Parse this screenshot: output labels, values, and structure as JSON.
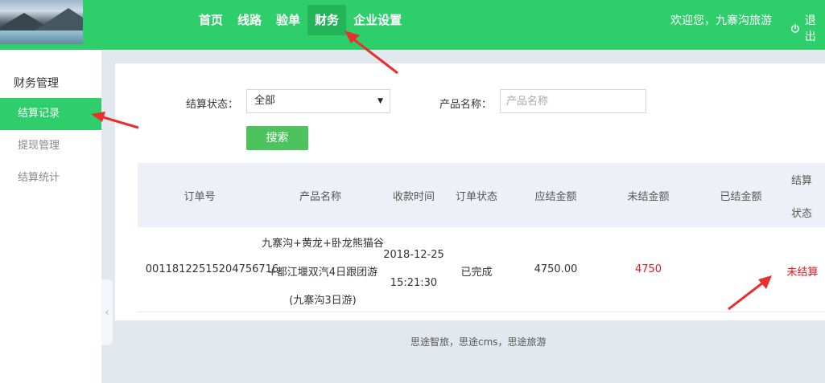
{
  "header": {
    "nav": [
      {
        "label": "首页"
      },
      {
        "label": "线路"
      },
      {
        "label": "验单"
      },
      {
        "label": "财务",
        "active": true
      },
      {
        "label": "企业设置"
      }
    ],
    "welcome": "欢迎您，九寨沟旅游",
    "logout_label": "退出"
  },
  "sidebar": {
    "title": "财务管理",
    "items": [
      {
        "label": "结算记录",
        "active": true
      },
      {
        "label": "提现管理"
      },
      {
        "label": "结算统计"
      }
    ],
    "collapse_glyph": "‹"
  },
  "filters": {
    "status_label": "结算状态：",
    "status_value": "全部",
    "product_label": "产品名称：",
    "product_placeholder": "产品名称",
    "product_value": "",
    "search_label": "搜索"
  },
  "table": {
    "columns": [
      "订单号",
      "产品名称",
      "收款时间",
      "订单状态",
      "应结金额",
      "未结金额",
      "已结金额",
      "结算",
      "状态"
    ],
    "rows": [
      {
        "order_no": "00118122515204756716",
        "product_lines": [
          "九寨沟+黄龙+卧龙熊猫谷",
          "+都江堰双汽4日跟团游",
          "(九寨沟3日游)"
        ],
        "pay_date": "2018-12-25",
        "pay_time": "15:21:30",
        "order_status": "已完成",
        "amount_due": "4750.00",
        "amount_unsettled": "4750",
        "amount_settled": "",
        "settle_status": "未结算"
      }
    ]
  },
  "footer": "思途智旅，思途cms，思途旅游",
  "colors": {
    "brand_green": "#2ecf6a",
    "active_nav": "#24b45a",
    "button_green": "#4cc35d",
    "alert_red": "#e0181f",
    "page_bg": "#e3e8ef",
    "table_head_bg": "#edf1f7"
  },
  "icons": [
    "power-icon",
    "chevron-down-icon",
    "chevron-left-icon"
  ]
}
